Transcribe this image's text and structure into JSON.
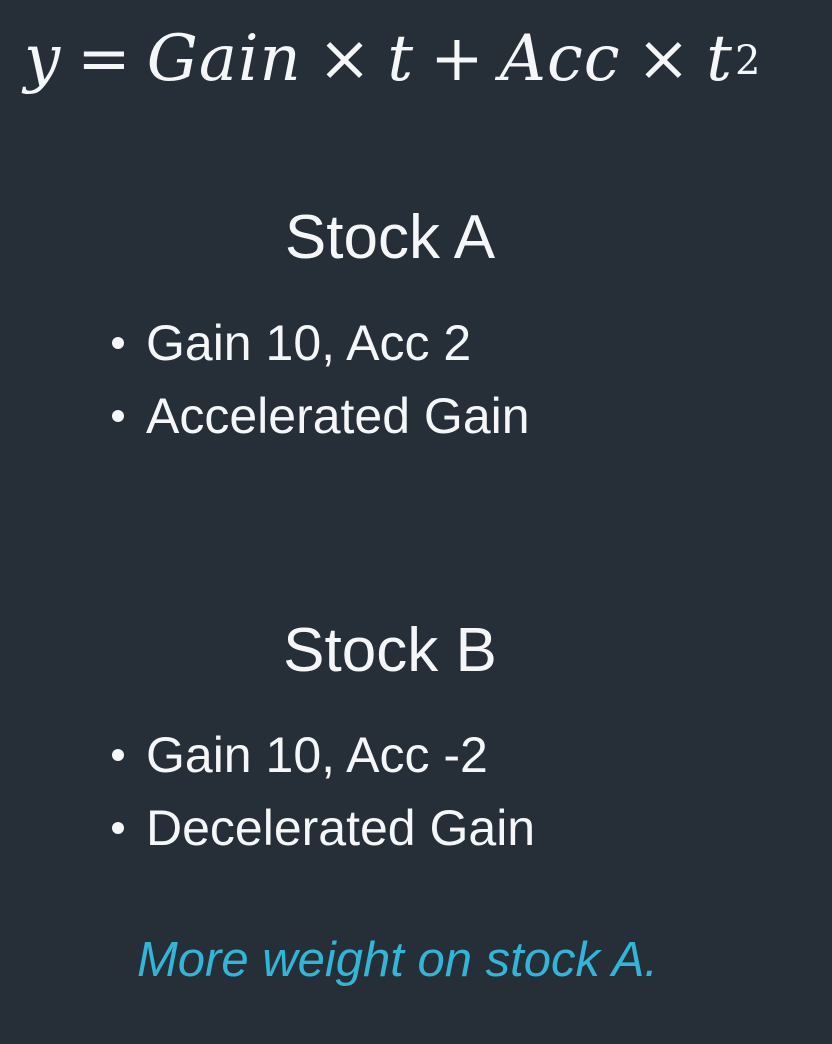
{
  "formula": {
    "y": "y",
    "equals": "=",
    "gain": "Gain",
    "times1": "×",
    "t1": "t",
    "plus": "+",
    "acc": "Acc",
    "times2": "×",
    "t2": "t",
    "exponent": "2"
  },
  "stock_a": {
    "title": "Stock A",
    "bullets": [
      "Gain 10, Acc 2",
      "Accelerated Gain"
    ]
  },
  "stock_b": {
    "title": "Stock B",
    "bullets": [
      "Gain 10, Acc -2",
      "Decelerated Gain"
    ]
  },
  "note": "More weight on stock A.",
  "colors": {
    "background": "#262f38",
    "text": "#f4f6f8",
    "accent": "#33b5d8"
  }
}
